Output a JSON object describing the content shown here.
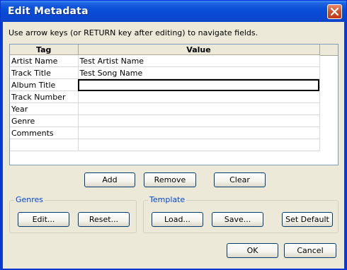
{
  "window": {
    "title": "Edit Metadata"
  },
  "instruction": "Use arrow keys (or RETURN key after editing) to navigate fields.",
  "table": {
    "columns": [
      "Tag",
      "Value"
    ],
    "rows": [
      {
        "tag": "Artist Name",
        "value": "Test Artist Name"
      },
      {
        "tag": "Track Title",
        "value": "Test Song Name"
      },
      {
        "tag": "Album Title",
        "value": ""
      },
      {
        "tag": "Track Number",
        "value": ""
      },
      {
        "tag": "Year",
        "value": ""
      },
      {
        "tag": "Genre",
        "value": ""
      },
      {
        "tag": "Comments",
        "value": ""
      }
    ]
  },
  "buttons": {
    "add": "Add",
    "remove": "Remove",
    "clear": "Clear",
    "ok": "OK",
    "cancel": "Cancel"
  },
  "genres": {
    "label": "Genres",
    "edit": "Edit...",
    "reset": "Reset..."
  },
  "template": {
    "label": "Template",
    "load": "Load...",
    "save": "Save...",
    "set_default": "Set Default"
  },
  "icons": {
    "close": "close-icon"
  }
}
